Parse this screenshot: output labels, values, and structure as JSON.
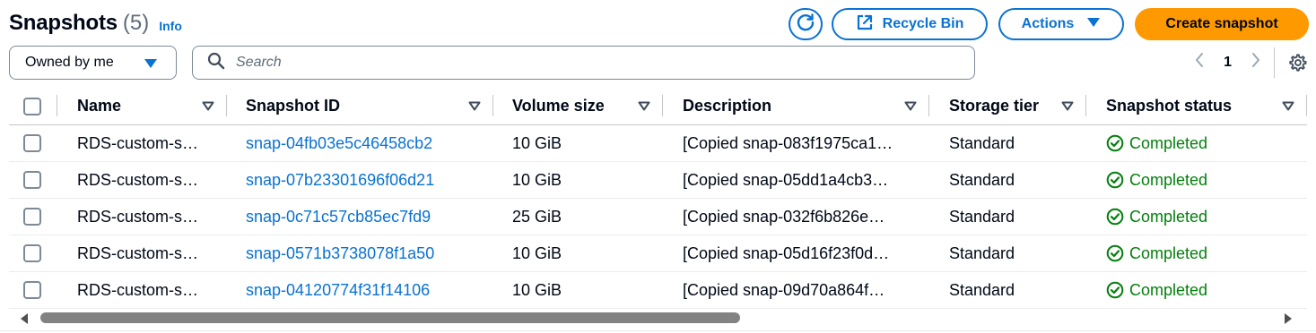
{
  "header": {
    "title": "Snapshots",
    "count": "(5)",
    "info": "Info"
  },
  "toolbar": {
    "recycle_label": "Recycle Bin",
    "actions_label": "Actions",
    "create_label": "Create snapshot"
  },
  "filter": {
    "owner_selected": "Owned by me",
    "search_placeholder": "Search",
    "page": "1"
  },
  "table": {
    "columns": [
      "Name",
      "Snapshot ID",
      "Volume size",
      "Description",
      "Storage tier",
      "Snapshot status"
    ],
    "rows": [
      {
        "name": "RDS-custom-s…",
        "id": "snap-04fb03e5c46458cb2",
        "size": "10 GiB",
        "desc": "[Copied snap-083f1975ca1…",
        "tier": "Standard",
        "status": "Completed"
      },
      {
        "name": "RDS-custom-s…",
        "id": "snap-07b23301696f06d21",
        "size": "10 GiB",
        "desc": "[Copied snap-05dd1a4cb3…",
        "tier": "Standard",
        "status": "Completed"
      },
      {
        "name": "RDS-custom-s…",
        "id": "snap-0c71c57cb85ec7fd9",
        "size": "25 GiB",
        "desc": "[Copied snap-032f6b826e…",
        "tier": "Standard",
        "status": "Completed"
      },
      {
        "name": "RDS-custom-s…",
        "id": "snap-0571b3738078f1a50",
        "size": "10 GiB",
        "desc": "[Copied snap-05d16f23f0d…",
        "tier": "Standard",
        "status": "Completed"
      },
      {
        "name": "RDS-custom-s…",
        "id": "snap-04120774f31f14106",
        "size": "10 GiB",
        "desc": "[Copied snap-09d70a864f…",
        "tier": "Standard",
        "status": "Completed"
      }
    ]
  },
  "icons": {
    "refresh": "refresh-icon",
    "external": "external-link-icon",
    "caret": "caret-down-icon",
    "search": "search-icon",
    "gear": "gear-icon",
    "status": "check-circle-icon"
  },
  "colors": {
    "primary": "#0972d3",
    "accent": "#ff9900",
    "success": "#037f0c",
    "text": "#000716"
  }
}
